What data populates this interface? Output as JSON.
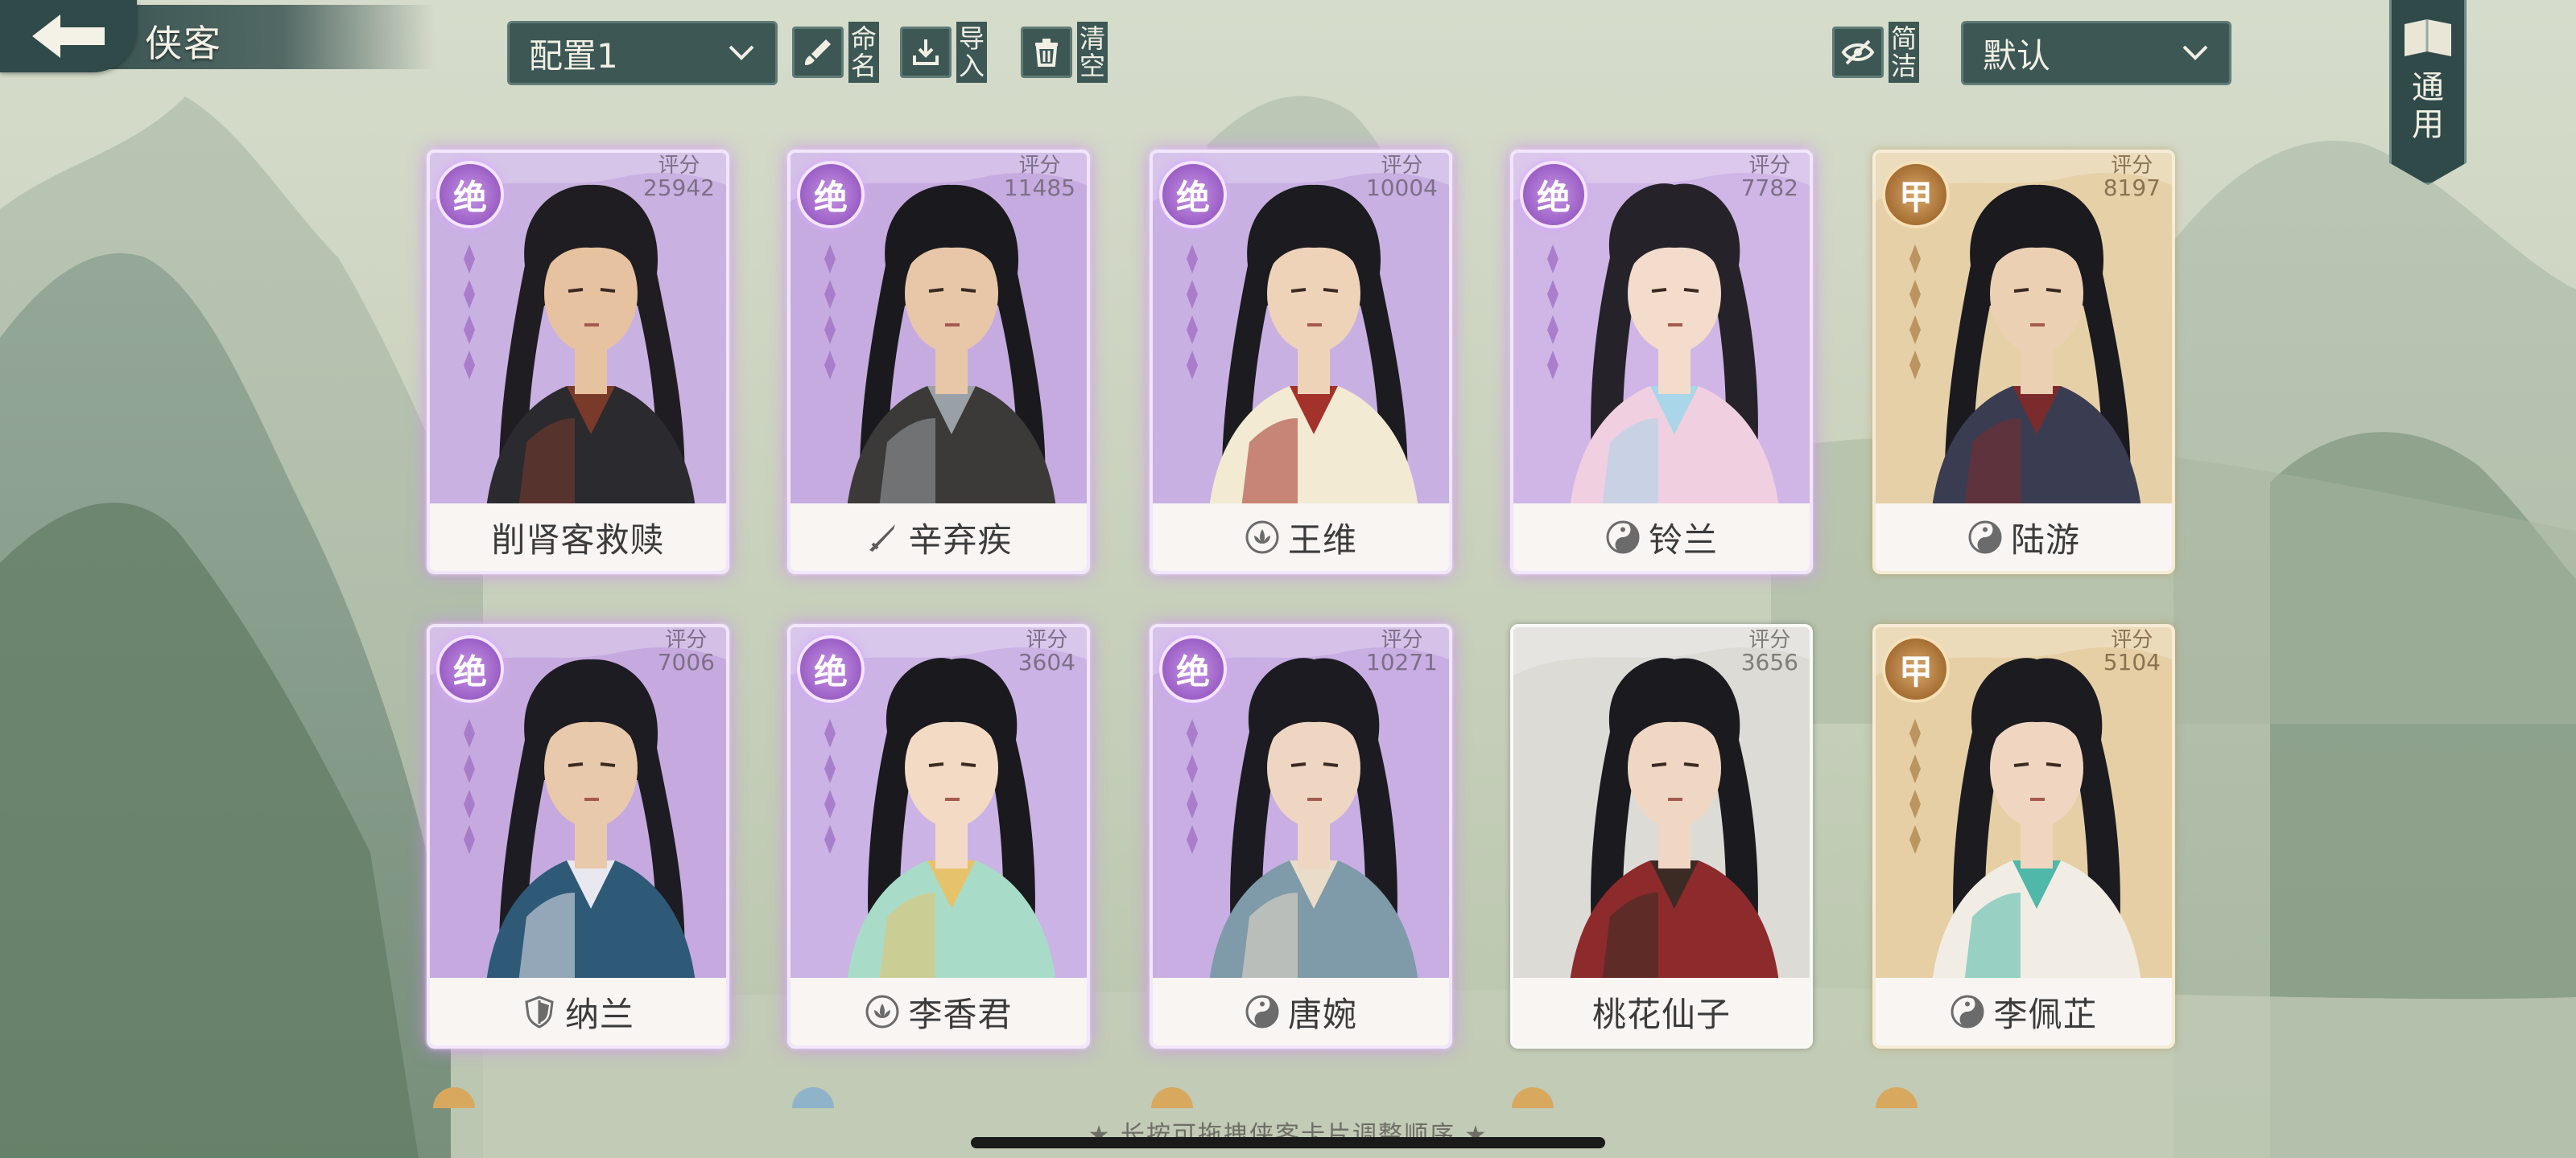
{
  "header": {
    "title": "侠客",
    "config_select": "配置1",
    "sort_select": "默认",
    "buttons": {
      "rename": "命名",
      "import": "导入",
      "clear": "清空",
      "simple": "简洁",
      "general": "通用"
    }
  },
  "cards": [
    {
      "name": "削肾客救赎",
      "score_label": "评分",
      "score": "25942",
      "badge": "绝",
      "tier": "purple",
      "symbol": "none",
      "stars": 4,
      "palette": {
        "hair": "#1f1d22",
        "skin": "#e7c2a0",
        "robe": "#2b2a2f",
        "accent": "#7a3a2a",
        "bg": "#c9b1e2"
      }
    },
    {
      "name": "辛弃疾",
      "score_label": "评分",
      "score": "11485",
      "badge": "绝",
      "tier": "purple",
      "symbol": "sword",
      "stars": 4,
      "palette": {
        "hair": "#1a1a1e",
        "skin": "#e8c7a8",
        "robe": "#3c3a38",
        "accent": "#9aa1a6",
        "bg": "#c6abe0"
      }
    },
    {
      "name": "王维",
      "score_label": "评分",
      "score": "10004",
      "badge": "绝",
      "tier": "purple",
      "symbol": "lotus",
      "stars": 4,
      "palette": {
        "hair": "#1b1b20",
        "skin": "#efd3b8",
        "robe": "#f3ead3",
        "accent": "#a3322b",
        "bg": "#c9b0e3"
      }
    },
    {
      "name": "铃兰",
      "score_label": "评分",
      "score": "7782",
      "badge": "绝",
      "tier": "purple",
      "symbol": "taiji",
      "stars": 4,
      "palette": {
        "hair": "#252229",
        "skin": "#f3dccb",
        "robe": "#efcfe0",
        "accent": "#a9d6e8",
        "bg": "#cfb6e6"
      }
    },
    {
      "name": "陆游",
      "score_label": "评分",
      "score": "8197",
      "badge": "甲",
      "tier": "gold",
      "symbol": "taiji",
      "stars": 4,
      "palette": {
        "hair": "#1b1a1e",
        "skin": "#ecd0b4",
        "robe": "#3a3d52",
        "accent": "#7b2b2b",
        "bg": "#e6d0a8"
      }
    },
    {
      "name": "纳兰",
      "score_label": "评分",
      "score": "7006",
      "badge": "绝",
      "tier": "purple",
      "symbol": "shield",
      "stars": 4,
      "palette": {
        "hair": "#1d1c22",
        "skin": "#e9c9ab",
        "robe": "#2e5a78",
        "accent": "#e9e7ef",
        "bg": "#c6aadf"
      }
    },
    {
      "name": "李香君",
      "score_label": "评分",
      "score": "3604",
      "badge": "绝",
      "tier": "purple",
      "symbol": "lotus",
      "stars": 4,
      "palette": {
        "hair": "#1a191e",
        "skin": "#f2dac5",
        "robe": "#a8dcc8",
        "accent": "#e6c36a",
        "bg": "#cbb3e5"
      }
    },
    {
      "name": "唐婉",
      "score_label": "评分",
      "score": "10271",
      "badge": "绝",
      "tier": "purple",
      "symbol": "taiji",
      "stars": 4,
      "palette": {
        "hair": "#1c1b22",
        "skin": "#efd6c2",
        "robe": "#7f9aa8",
        "accent": "#e9dcc8",
        "bg": "#c8aee2"
      }
    },
    {
      "name": "桃花仙子",
      "score_label": "评分",
      "score": "3656",
      "badge": "",
      "tier": "white",
      "symbol": "none",
      "stars": 0,
      "palette": {
        "hair": "#1b1a1f",
        "skin": "#f0d7c4",
        "robe": "#8d2a2c",
        "accent": "#3b2b24",
        "bg": "#dcdbd6"
      }
    },
    {
      "name": "李佩芷",
      "score_label": "评分",
      "score": "5104",
      "badge": "甲",
      "tier": "gold",
      "symbol": "taiji",
      "stars": 4,
      "palette": {
        "hair": "#1c1b20",
        "skin": "#f0d6c0",
        "robe": "#f2ede4",
        "accent": "#4fb8a9",
        "bg": "#e6cfa5"
      }
    }
  ],
  "hint": "★ 长按可拖拽侠客卡片调整顺序 ★"
}
